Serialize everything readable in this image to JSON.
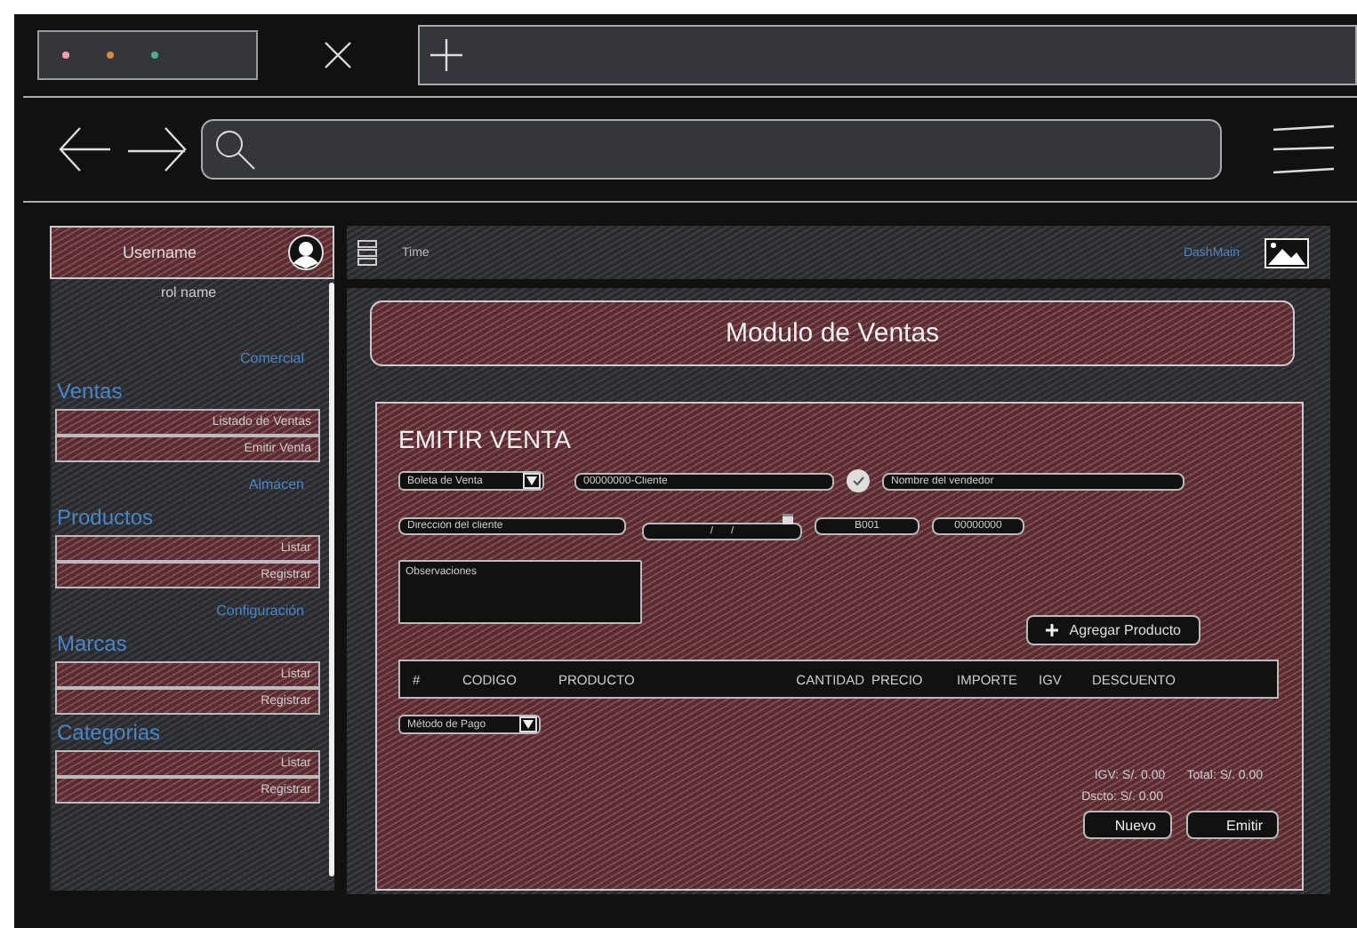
{
  "user": {
    "name": "Username",
    "role": "rol name"
  },
  "sidebar": {
    "sections": [
      {
        "group": "Comercial",
        "title": "Ventas",
        "items": [
          "Listado de Ventas",
          "Emitir Venta"
        ]
      },
      {
        "group": "Almacen",
        "title": "Productos",
        "items": [
          "Listar",
          "Registrar"
        ]
      },
      {
        "group": "Configuración",
        "title": "Marcas",
        "items": [
          "Listar",
          "Registrar"
        ]
      },
      {
        "title": "Categorias",
        "items": [
          "Listar",
          "Registrar"
        ]
      }
    ]
  },
  "topbar": {
    "time": "Time",
    "link": "DashMain"
  },
  "module_title": "Modulo de Ventas",
  "form": {
    "title": "EMITIR VENTA",
    "document_type": "Boleta de Venta",
    "client": {
      "placeholder": "00000000-Cliente"
    },
    "seller": {
      "placeholder": "Nombre del vendedor"
    },
    "address": {
      "placeholder": "Dirección del cliente"
    },
    "date": {
      "placeholder": "/      /"
    },
    "series": {
      "placeholder": "B001"
    },
    "number": {
      "placeholder": "00000000"
    },
    "notes": {
      "placeholder": "Observaciones"
    },
    "add_button": "Agregar Producto",
    "columns": [
      "#",
      "CODIGO",
      "PRODUCTO",
      "CANTIDAD",
      "PRECIO",
      "IMPORTE",
      "IGV",
      "DESCUENTO"
    ],
    "payment_method": "Método de Pago",
    "totals": {
      "igv": "IGV: S/. 0.00",
      "total": "Total: S/. 0.00",
      "discount": "Dscto: S/. 0.00"
    },
    "buttons": [
      "Nuevo",
      "Emitir"
    ]
  }
}
